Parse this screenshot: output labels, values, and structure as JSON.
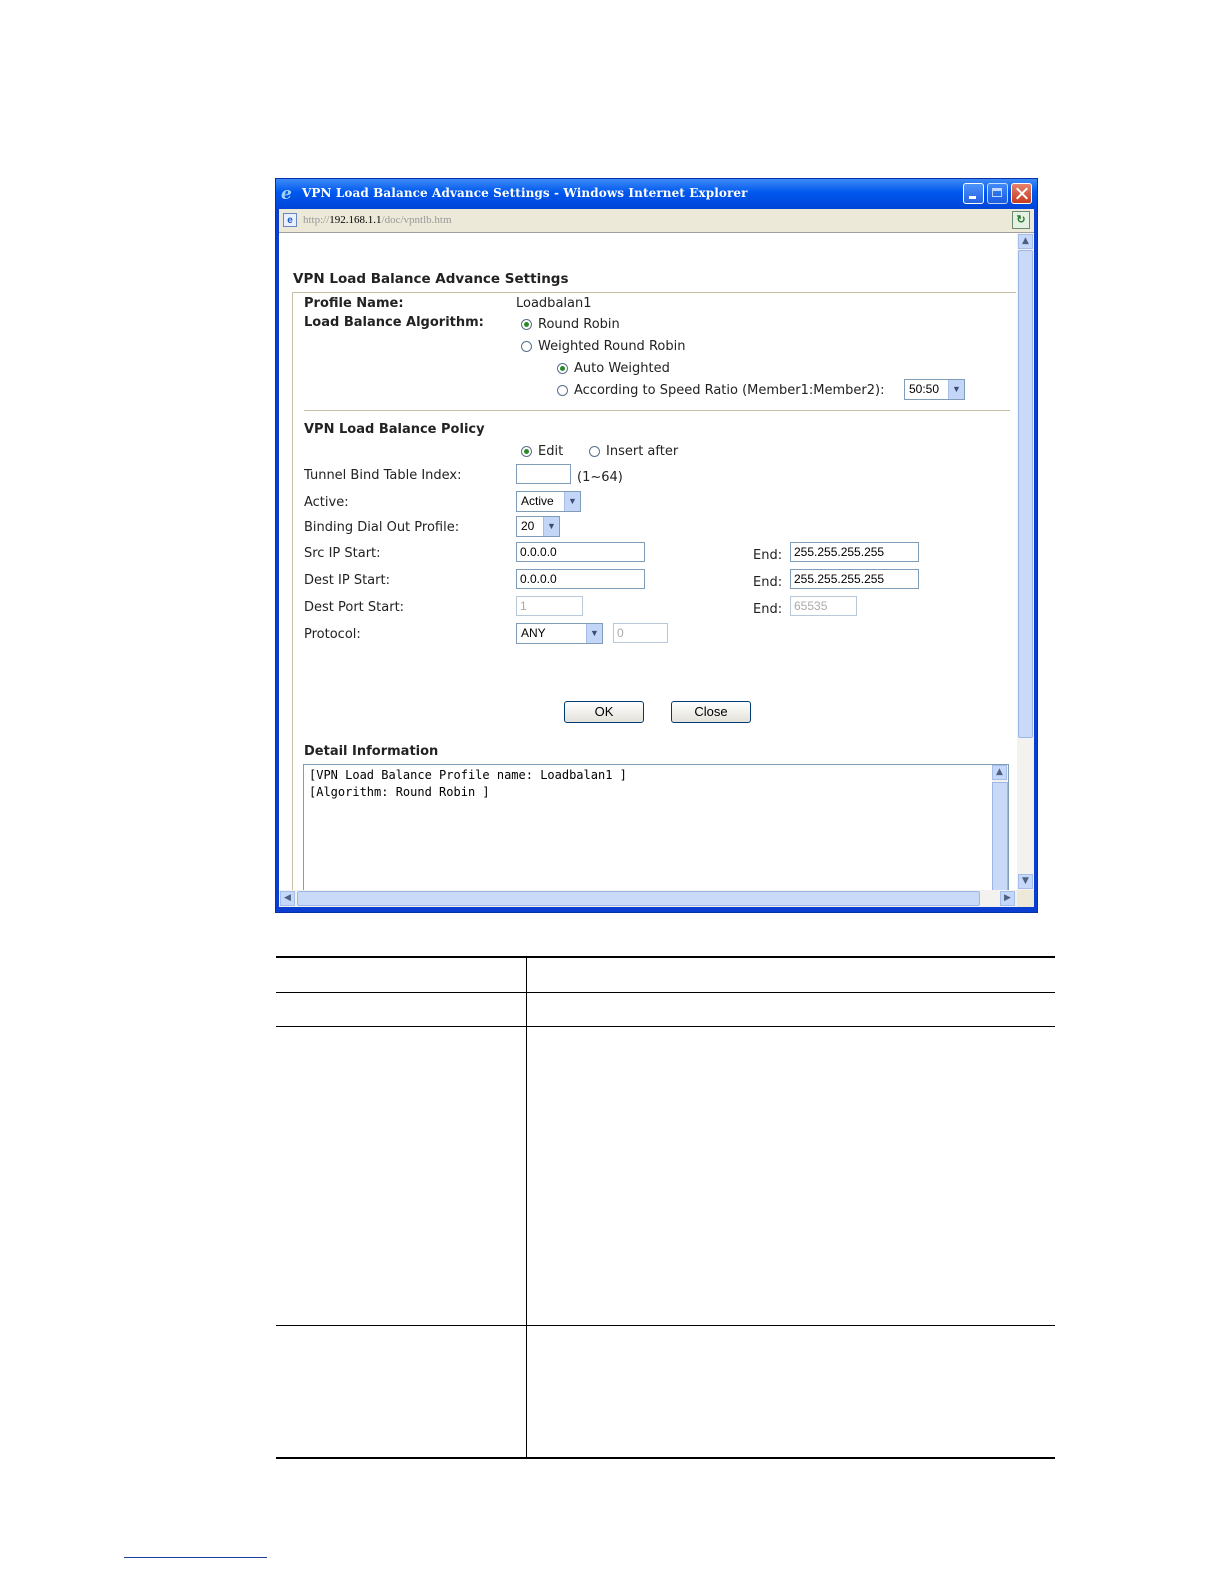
{
  "window": {
    "title": "VPN Load Balance Advance Settings - Windows Internet Explorer",
    "url_prefix": "http://",
    "url_host": "192.168.1.1",
    "url_path": "/doc/vpntlb.htm"
  },
  "page": {
    "heading": "VPN Load Balance Advance Settings",
    "profile_name_label": "Profile Name:",
    "profile_name_value": "Loadbalan1",
    "algorithm_label": "Load Balance Algorithm:",
    "algo_round_robin": "Round Robin",
    "algo_weighted": "Weighted Round Robin",
    "auto_weighted": "Auto Weighted",
    "speed_ratio": "According to Speed Ratio (Member1:Member2):",
    "speed_ratio_value": "50:50",
    "policy_heading": "VPN Load Balance Policy",
    "edit_label": "Edit",
    "insert_after_label": "Insert after",
    "tunnel_index_label": "Tunnel Bind Table Index:",
    "tunnel_index_value": "",
    "tunnel_index_range": "(1~64)",
    "active_label": "Active:",
    "active_value": "Active",
    "binding_label": "Binding Dial Out Profile:",
    "binding_value": "20",
    "src_ip_label": "Src IP Start:",
    "src_ip_start": "0.0.0.0",
    "src_ip_end_label": "End:",
    "src_ip_end": "255.255.255.255",
    "dest_ip_label": "Dest IP Start:",
    "dest_ip_start": "0.0.0.0",
    "dest_ip_end_label": "End:",
    "dest_ip_end": "255.255.255.255",
    "dest_port_label": "Dest Port Start:",
    "dest_port_start": "1",
    "dest_port_end_label": "End:",
    "dest_port_end": "65535",
    "protocol_label": "Protocol:",
    "protocol_value": "ANY",
    "protocol_number": "0",
    "ok_label": "OK",
    "close_label": "Close",
    "detail_heading": "Detail Information",
    "detail_lines": [
      "[VPN Load Balance Profile name: Loadbalan1 ]",
      "[Algorithm: Round Robin ]"
    ]
  },
  "colors": {
    "titlebar": "#0058ee",
    "radio_dot": "#2a8a2a",
    "input_border": "#7f9db9"
  }
}
